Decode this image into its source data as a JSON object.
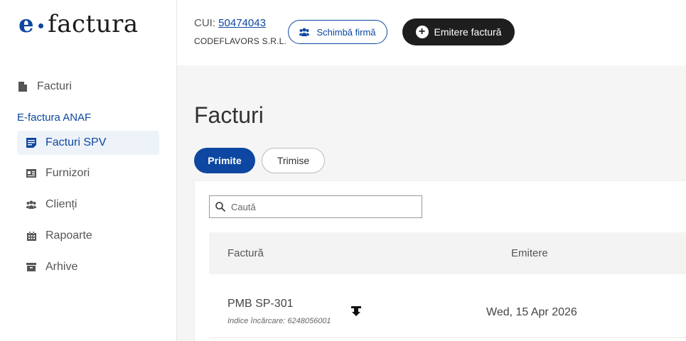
{
  "logo": {
    "e": "e",
    "rest": "factura"
  },
  "sidebar": {
    "items": [
      {
        "label": "Facturi",
        "icon": "document-icon"
      },
      {
        "label": "Facturi SPV",
        "icon": "invoice-list-icon"
      },
      {
        "label": "Furnizori",
        "icon": "id-card-icon"
      },
      {
        "label": "Clienți",
        "icon": "people-icon"
      },
      {
        "label": "Rapoarte",
        "icon": "calendar-icon"
      },
      {
        "label": "Arhive",
        "icon": "archive-icon"
      }
    ],
    "section_title": "E-factura ANAF"
  },
  "header": {
    "cui_label": "CUI:",
    "cui_value": "50474043",
    "company": "CODEFLAVORS S.R.L.",
    "change_company_label": "Schimbă firmă",
    "emit_invoice_label": "Emitere factură"
  },
  "main": {
    "title": "Facturi",
    "tabs": [
      {
        "label": "Primite",
        "active": true
      },
      {
        "label": "Trimise",
        "active": false
      }
    ],
    "search": {
      "placeholder": "Caută",
      "value": ""
    },
    "table": {
      "columns": [
        "Factură",
        "Emitere"
      ],
      "rows": [
        {
          "name": "PMB SP-301",
          "index": "Indice încărcare: 6248056001",
          "date": "Wed, 15 Apr 2026"
        }
      ]
    }
  },
  "colors": {
    "primary": "#0d47a1",
    "dark_button": "#1e1e1e",
    "active_nav_bg": "#edf3f8"
  }
}
